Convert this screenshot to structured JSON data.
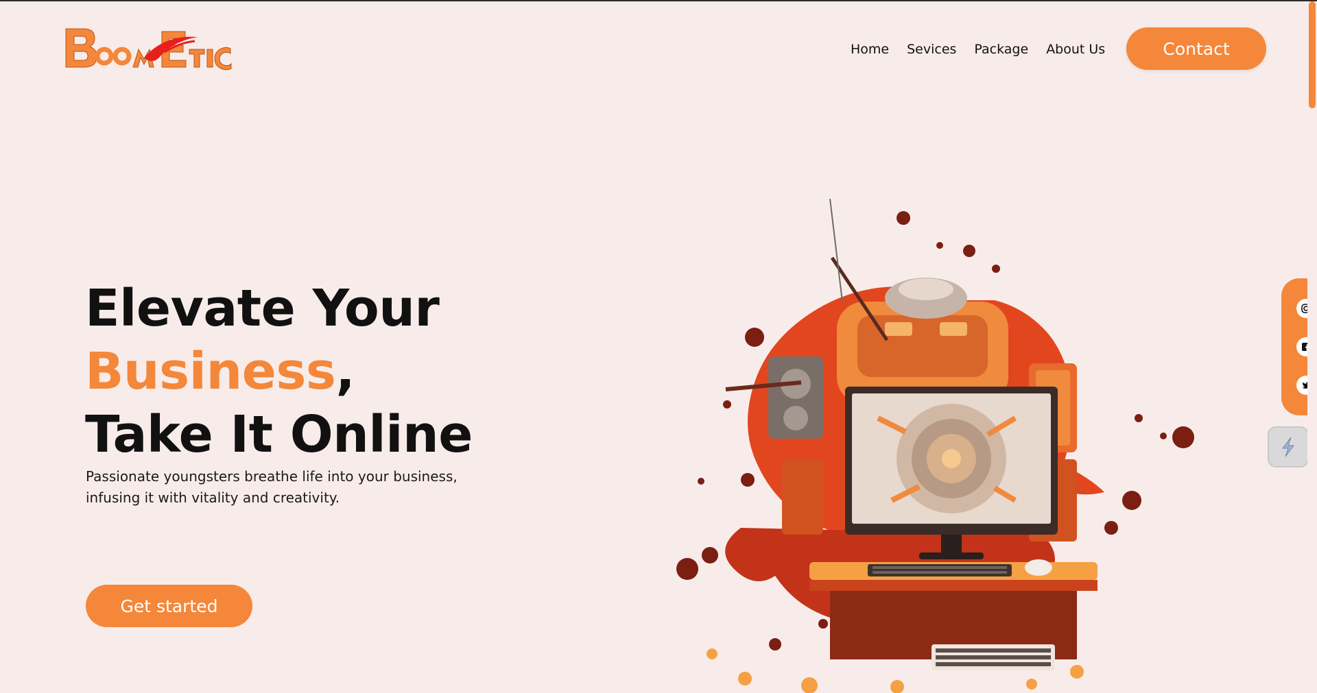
{
  "brand": {
    "logo_text": "BoomEtic",
    "accent_color": "#f4873a",
    "logo_red": "#e8201c"
  },
  "nav": {
    "items": [
      {
        "label": "Home"
      },
      {
        "label": "Sevices"
      },
      {
        "label": "Package"
      },
      {
        "label": "About Us"
      }
    ],
    "contact_label": "Contact"
  },
  "hero": {
    "title_line1": "Elevate Your",
    "title_accent": "Business",
    "title_comma": ",",
    "title_line3": "Take It Online",
    "subtitle_line1": "Passionate youngsters breathe life into your business,",
    "subtitle_line2": "infusing it with vitality and creativity.",
    "cta_label": "Get started"
  },
  "social": {
    "icons": [
      "instagram-icon",
      "facebook-icon",
      "twitter-icon"
    ],
    "extension_icon": "lightning-icon"
  },
  "scrollbar": {
    "position_fraction": 0
  }
}
